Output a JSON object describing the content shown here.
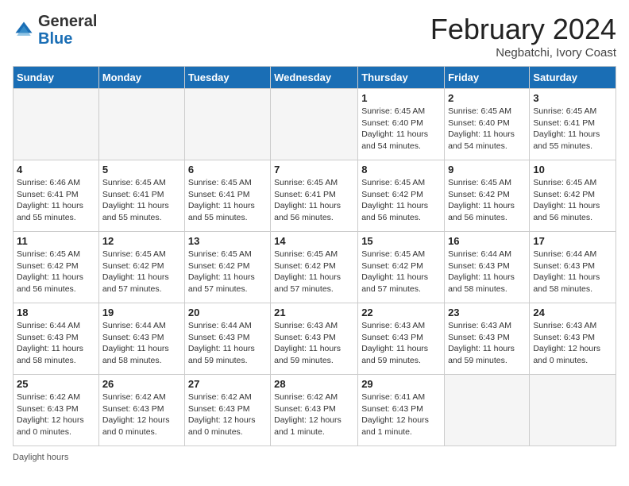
{
  "header": {
    "logo_general": "General",
    "logo_blue": "Blue",
    "month_year": "February 2024",
    "location": "Negbatchi, Ivory Coast"
  },
  "weekdays": [
    "Sunday",
    "Monday",
    "Tuesday",
    "Wednesday",
    "Thursday",
    "Friday",
    "Saturday"
  ],
  "weeks": [
    [
      {
        "day": "",
        "info": ""
      },
      {
        "day": "",
        "info": ""
      },
      {
        "day": "",
        "info": ""
      },
      {
        "day": "",
        "info": ""
      },
      {
        "day": "1",
        "info": "Sunrise: 6:45 AM\nSunset: 6:40 PM\nDaylight: 11 hours and 54 minutes."
      },
      {
        "day": "2",
        "info": "Sunrise: 6:45 AM\nSunset: 6:40 PM\nDaylight: 11 hours and 54 minutes."
      },
      {
        "day": "3",
        "info": "Sunrise: 6:45 AM\nSunset: 6:41 PM\nDaylight: 11 hours and 55 minutes."
      }
    ],
    [
      {
        "day": "4",
        "info": "Sunrise: 6:46 AM\nSunset: 6:41 PM\nDaylight: 11 hours and 55 minutes."
      },
      {
        "day": "5",
        "info": "Sunrise: 6:45 AM\nSunset: 6:41 PM\nDaylight: 11 hours and 55 minutes."
      },
      {
        "day": "6",
        "info": "Sunrise: 6:45 AM\nSunset: 6:41 PM\nDaylight: 11 hours and 55 minutes."
      },
      {
        "day": "7",
        "info": "Sunrise: 6:45 AM\nSunset: 6:41 PM\nDaylight: 11 hours and 56 minutes."
      },
      {
        "day": "8",
        "info": "Sunrise: 6:45 AM\nSunset: 6:42 PM\nDaylight: 11 hours and 56 minutes."
      },
      {
        "day": "9",
        "info": "Sunrise: 6:45 AM\nSunset: 6:42 PM\nDaylight: 11 hours and 56 minutes."
      },
      {
        "day": "10",
        "info": "Sunrise: 6:45 AM\nSunset: 6:42 PM\nDaylight: 11 hours and 56 minutes."
      }
    ],
    [
      {
        "day": "11",
        "info": "Sunrise: 6:45 AM\nSunset: 6:42 PM\nDaylight: 11 hours and 56 minutes."
      },
      {
        "day": "12",
        "info": "Sunrise: 6:45 AM\nSunset: 6:42 PM\nDaylight: 11 hours and 57 minutes."
      },
      {
        "day": "13",
        "info": "Sunrise: 6:45 AM\nSunset: 6:42 PM\nDaylight: 11 hours and 57 minutes."
      },
      {
        "day": "14",
        "info": "Sunrise: 6:45 AM\nSunset: 6:42 PM\nDaylight: 11 hours and 57 minutes."
      },
      {
        "day": "15",
        "info": "Sunrise: 6:45 AM\nSunset: 6:42 PM\nDaylight: 11 hours and 57 minutes."
      },
      {
        "day": "16",
        "info": "Sunrise: 6:44 AM\nSunset: 6:43 PM\nDaylight: 11 hours and 58 minutes."
      },
      {
        "day": "17",
        "info": "Sunrise: 6:44 AM\nSunset: 6:43 PM\nDaylight: 11 hours and 58 minutes."
      }
    ],
    [
      {
        "day": "18",
        "info": "Sunrise: 6:44 AM\nSunset: 6:43 PM\nDaylight: 11 hours and 58 minutes."
      },
      {
        "day": "19",
        "info": "Sunrise: 6:44 AM\nSunset: 6:43 PM\nDaylight: 11 hours and 58 minutes."
      },
      {
        "day": "20",
        "info": "Sunrise: 6:44 AM\nSunset: 6:43 PM\nDaylight: 11 hours and 59 minutes."
      },
      {
        "day": "21",
        "info": "Sunrise: 6:43 AM\nSunset: 6:43 PM\nDaylight: 11 hours and 59 minutes."
      },
      {
        "day": "22",
        "info": "Sunrise: 6:43 AM\nSunset: 6:43 PM\nDaylight: 11 hours and 59 minutes."
      },
      {
        "day": "23",
        "info": "Sunrise: 6:43 AM\nSunset: 6:43 PM\nDaylight: 11 hours and 59 minutes."
      },
      {
        "day": "24",
        "info": "Sunrise: 6:43 AM\nSunset: 6:43 PM\nDaylight: 12 hours and 0 minutes."
      }
    ],
    [
      {
        "day": "25",
        "info": "Sunrise: 6:42 AM\nSunset: 6:43 PM\nDaylight: 12 hours and 0 minutes."
      },
      {
        "day": "26",
        "info": "Sunrise: 6:42 AM\nSunset: 6:43 PM\nDaylight: 12 hours and 0 minutes."
      },
      {
        "day": "27",
        "info": "Sunrise: 6:42 AM\nSunset: 6:43 PM\nDaylight: 12 hours and 0 minutes."
      },
      {
        "day": "28",
        "info": "Sunrise: 6:42 AM\nSunset: 6:43 PM\nDaylight: 12 hours and 1 minute."
      },
      {
        "day": "29",
        "info": "Sunrise: 6:41 AM\nSunset: 6:43 PM\nDaylight: 12 hours and 1 minute."
      },
      {
        "day": "",
        "info": ""
      },
      {
        "day": "",
        "info": ""
      }
    ]
  ],
  "footer": {
    "daylight_hours_label": "Daylight hours"
  }
}
